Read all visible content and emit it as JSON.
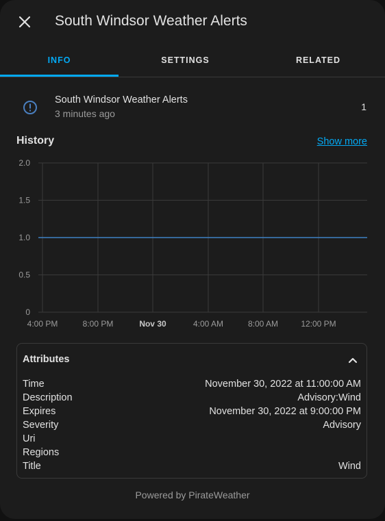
{
  "dialog": {
    "title": "South Windsor Weather Alerts",
    "close_icon": "close-icon"
  },
  "tabs": [
    {
      "label": "INFO",
      "active": true
    },
    {
      "label": "SETTINGS",
      "active": false
    },
    {
      "label": "RELATED",
      "active": false
    }
  ],
  "entity": {
    "icon": "alert-circle-icon",
    "name": "South Windsor Weather Alerts",
    "last_changed": "3 minutes ago",
    "state": "1"
  },
  "history": {
    "title": "History",
    "show_more": "Show more"
  },
  "chart_data": {
    "type": "line",
    "y_ticks": [
      "2.0",
      "1.5",
      "1.0",
      "0.5",
      "0"
    ],
    "x_ticks": [
      "4:00 PM",
      "8:00 PM",
      "Nov 30",
      "4:00 AM",
      "8:00 AM",
      "12:00 PM"
    ],
    "x_ticks_bold": [
      false,
      false,
      true,
      false,
      false,
      false
    ],
    "ylim": [
      0,
      2
    ],
    "series": [
      {
        "color": "#3f81c4",
        "points": [
          {
            "x": "3:55 PM",
            "y": 1
          },
          {
            "x": "3:50 PM (+1 day)",
            "y": 1
          }
        ]
      }
    ],
    "grid": true
  },
  "attributes": {
    "title": "Attributes",
    "toggle_icon": "chevron-up-icon",
    "rows": [
      {
        "key": "Time",
        "value": "November 30, 2022 at 11:00:00 AM"
      },
      {
        "key": "Description",
        "value": "Advisory:Wind"
      },
      {
        "key": "Expires",
        "value": "November 30, 2022 at 9:00:00 PM"
      },
      {
        "key": "Severity",
        "value": "Advisory"
      },
      {
        "key": "Uri",
        "value": ""
      },
      {
        "key": "Regions",
        "value": ""
      },
      {
        "key": "Title",
        "value": "Wind"
      }
    ]
  },
  "footer": {
    "text": "Powered by PirateWeather"
  },
  "colors": {
    "accent": "#03a9f4",
    "background": "#1c1c1c",
    "series": "#3f81c4"
  }
}
